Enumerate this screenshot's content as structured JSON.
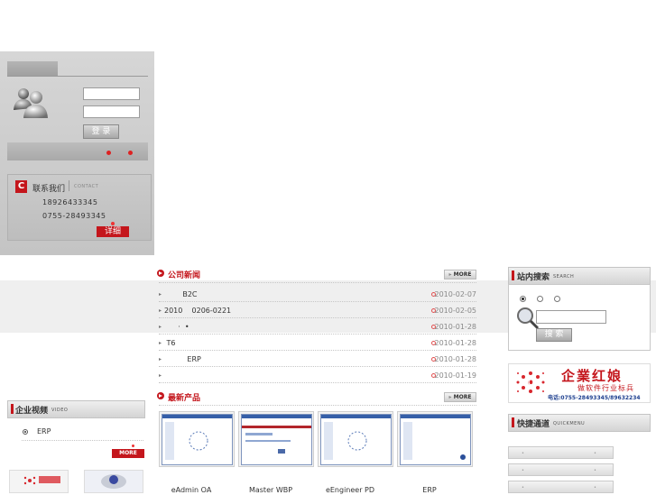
{
  "login": {
    "submit_label": "登 录",
    "username_value": "",
    "password_value": ""
  },
  "contact": {
    "icon_letter": "C",
    "title": "联系我们",
    "title_en": "CONTACT",
    "phone1": "18926433345",
    "phone2": "0755-28493345",
    "detail_label": "详细"
  },
  "news": {
    "title": "公司新闻",
    "more_label": "MORE",
    "items": [
      {
        "text": "        B2C",
        "date": "2010-02-07"
      },
      {
        "text": "2010    0206-0221",
        "date": "2010-02-05"
      },
      {
        "text": "      ·  •",
        "date": "2010-01-28"
      },
      {
        "text": " T6",
        "date": "2010-01-28"
      },
      {
        "text": "          ERP",
        "date": "2010-01-28"
      },
      {
        "text": "",
        "date": "2010-01-19"
      }
    ]
  },
  "products": {
    "title": "最新产品",
    "more_label": "MORE",
    "items": [
      {
        "label": "eAdmin OA"
      },
      {
        "label": "Master WBP"
      },
      {
        "label": "eEngineer PD"
      },
      {
        "label": "ERP"
      }
    ]
  },
  "search": {
    "title": "站内搜索",
    "title_en": "SEARCH",
    "submit_label": "搜 索",
    "query": ""
  },
  "banner": {
    "brand": "企業红娘",
    "slogan": "做软件行业标兵",
    "phone": "电话:0755-28493345/89632234"
  },
  "quickmenu": {
    "title": "快捷通道",
    "title_en": "QUICKMENU"
  },
  "video": {
    "title": "企业视频",
    "title_en": "VIDEO",
    "items": [
      {
        "label": "ERP"
      }
    ],
    "more_label": "MORE"
  },
  "colors": {
    "accent": "#c4161c",
    "panel": "#c9c9c9"
  }
}
